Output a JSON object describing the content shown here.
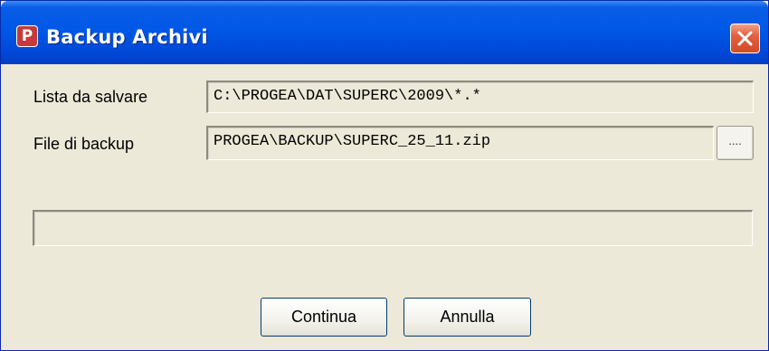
{
  "window": {
    "title": "Backup Archivi",
    "app_icon_glyph": "P",
    "icon": "app-icon",
    "close_icon": "close-icon"
  },
  "form": {
    "list_label": "Lista da salvare",
    "list_value": "C:\\PROGEA\\DAT\\SUPERC\\2009\\*.*",
    "backup_label": "File di backup",
    "backup_value": "PROGEA\\BACKUP\\SUPERC_25_11.zip",
    "browse_label": "...."
  },
  "progress": {
    "value": 0
  },
  "buttons": {
    "continue_label": "Continua",
    "cancel_label": "Annulla"
  },
  "colors": {
    "titlebar": "#0058e6",
    "dialog_background": "#ece9d8",
    "close_button": "#d24a2a"
  }
}
